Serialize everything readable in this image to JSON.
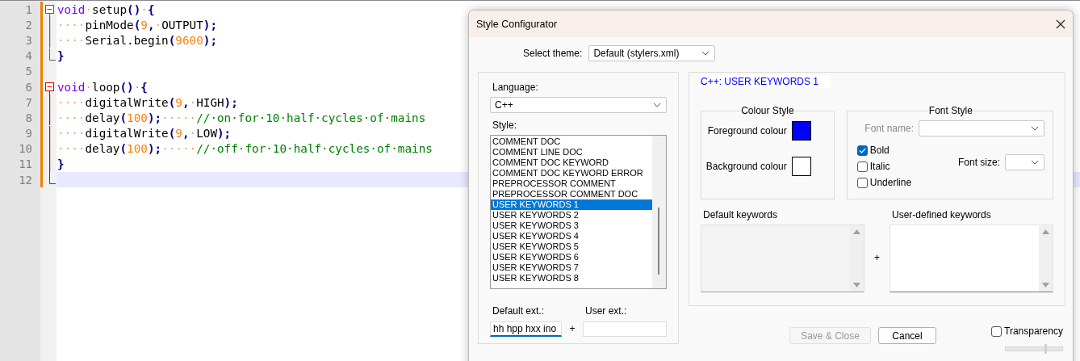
{
  "editor": {
    "lines": [
      {
        "number": "1",
        "changed": true,
        "kind": "open",
        "active_block": false,
        "current": false,
        "tokens": [
          {
            "kind": "kw",
            "text": "void"
          },
          {
            "kind": "ws",
            "text": "·"
          },
          {
            "kind": "id",
            "text": "setup"
          },
          {
            "kind": "op",
            "text": "()"
          },
          {
            "kind": "ws",
            "text": "·"
          },
          {
            "kind": "op",
            "text": "{"
          }
        ]
      },
      {
        "number": "2",
        "changed": true,
        "kind": "line",
        "active_block": false,
        "current": false,
        "tokens": [
          {
            "kind": "ws",
            "text": "····"
          },
          {
            "kind": "id",
            "text": "pinMode"
          },
          {
            "kind": "op",
            "text": "("
          },
          {
            "kind": "num",
            "text": "9"
          },
          {
            "kind": "op",
            "text": ","
          },
          {
            "kind": "ws",
            "text": "·"
          },
          {
            "kind": "id",
            "text": "OUTPUT"
          },
          {
            "kind": "op",
            "text": ");"
          }
        ]
      },
      {
        "number": "3",
        "changed": true,
        "kind": "line",
        "active_block": false,
        "current": false,
        "tokens": [
          {
            "kind": "ws",
            "text": "····"
          },
          {
            "kind": "id",
            "text": "Serial.begin"
          },
          {
            "kind": "op",
            "text": "("
          },
          {
            "kind": "num",
            "text": "9600"
          },
          {
            "kind": "op",
            "text": ");"
          }
        ]
      },
      {
        "number": "4",
        "changed": true,
        "kind": "end",
        "active_block": false,
        "current": false,
        "tokens": [
          {
            "kind": "op",
            "text": "}"
          }
        ]
      },
      {
        "number": "5",
        "changed": true,
        "current": false
      },
      {
        "number": "6",
        "changed": true,
        "kind": "open",
        "active_block": true,
        "current": false,
        "tokens": [
          {
            "kind": "kw",
            "text": "void"
          },
          {
            "kind": "ws",
            "text": "·"
          },
          {
            "kind": "id",
            "text": "loop"
          },
          {
            "kind": "op",
            "text": "()"
          },
          {
            "kind": "ws",
            "text": "·"
          },
          {
            "kind": "op",
            "text": "{"
          }
        ]
      },
      {
        "number": "7",
        "changed": true,
        "kind": "line",
        "active_block": true,
        "current": false,
        "tokens": [
          {
            "kind": "ws",
            "text": "····"
          },
          {
            "kind": "id",
            "text": "digitalWrite"
          },
          {
            "kind": "op",
            "text": "("
          },
          {
            "kind": "num",
            "text": "9"
          },
          {
            "kind": "op",
            "text": ","
          },
          {
            "kind": "ws",
            "text": "·"
          },
          {
            "kind": "id",
            "text": "HIGH"
          },
          {
            "kind": "op",
            "text": ");"
          }
        ]
      },
      {
        "number": "8",
        "changed": true,
        "kind": "line",
        "active_block": true,
        "current": false,
        "tokens": [
          {
            "kind": "ws",
            "text": "····"
          },
          {
            "kind": "id",
            "text": "delay"
          },
          {
            "kind": "op",
            "text": "("
          },
          {
            "kind": "num",
            "text": "100"
          },
          {
            "kind": "op",
            "text": ");"
          },
          {
            "kind": "ws",
            "text": "·····"
          },
          {
            "kind": "comment",
            "text": "//·on·for·10·half·cycles·of·mains"
          }
        ]
      },
      {
        "number": "9",
        "changed": true,
        "kind": "line",
        "active_block": true,
        "current": false,
        "tokens": [
          {
            "kind": "ws",
            "text": "····"
          },
          {
            "kind": "id",
            "text": "digitalWrite"
          },
          {
            "kind": "op",
            "text": "("
          },
          {
            "kind": "num",
            "text": "9"
          },
          {
            "kind": "op",
            "text": ","
          },
          {
            "kind": "ws",
            "text": "·"
          },
          {
            "kind": "id",
            "text": "LOW"
          },
          {
            "kind": "op",
            "text": ");"
          }
        ]
      },
      {
        "number": "10",
        "changed": true,
        "kind": "line",
        "active_block": true,
        "current": false,
        "tokens": [
          {
            "kind": "ws",
            "text": "····"
          },
          {
            "kind": "id",
            "text": "delay"
          },
          {
            "kind": "op",
            "text": "("
          },
          {
            "kind": "num",
            "text": "100"
          },
          {
            "kind": "op",
            "text": ");"
          },
          {
            "kind": "ws",
            "text": "·····"
          },
          {
            "kind": "comment",
            "text": "//·off·for·10·half·cycles·of·mains"
          }
        ]
      },
      {
        "number": "11",
        "changed": true,
        "kind": "line",
        "active_block": true,
        "current": false,
        "tokens": [
          {
            "kind": "op",
            "text": "}"
          }
        ]
      },
      {
        "number": "12",
        "changed": true,
        "kind": "end",
        "active_block": true,
        "current": true
      }
    ]
  },
  "dialog": {
    "title": "Style Configurator",
    "theme": {
      "label": "Select theme:",
      "value": "Default (stylers.xml)"
    },
    "language": {
      "label": "Language:",
      "value": "C++"
    },
    "style": {
      "label": "Style:",
      "items": [
        {
          "label": "COMMENT DOC",
          "selected": false
        },
        {
          "label": "COMMENT LINE DOC",
          "selected": false
        },
        {
          "label": "COMMENT DOC KEYWORD",
          "selected": false
        },
        {
          "label": "COMMENT DOC KEYWORD ERROR",
          "selected": false
        },
        {
          "label": "PREPROCESSOR COMMENT",
          "selected": false
        },
        {
          "label": "PREPROCESSOR COMMENT DOC",
          "selected": false
        },
        {
          "label": "USER KEYWORDS 1",
          "selected": true
        },
        {
          "label": "USER KEYWORDS 2",
          "selected": false
        },
        {
          "label": "USER KEYWORDS 3",
          "selected": false
        },
        {
          "label": "USER KEYWORDS 4",
          "selected": false
        },
        {
          "label": "USER KEYWORDS 5",
          "selected": false
        },
        {
          "label": "USER KEYWORDS 6",
          "selected": false
        },
        {
          "label": "USER KEYWORDS 7",
          "selected": false
        },
        {
          "label": "USER KEYWORDS 8",
          "selected": false
        }
      ]
    },
    "default_ext": {
      "label": "Default ext.:",
      "value": "hh hpp hxx ino"
    },
    "plus": "+",
    "user_ext": {
      "label": "User ext.:"
    },
    "style_title": "C++: USER KEYWORDS 1",
    "colour_style": {
      "title": "Colour Style",
      "foreground": {
        "label": "Foreground colour",
        "color": "#0000ff"
      },
      "background": {
        "label": "Background colour",
        "color": "#ffffff"
      }
    },
    "font_style": {
      "title": "Font Style",
      "font_name": {
        "label": "Font name:",
        "disabled": true
      },
      "checks": [
        {
          "label": "Bold",
          "checked": true
        },
        {
          "label": "Italic",
          "checked": false
        },
        {
          "label": "Underline",
          "checked": false
        }
      ],
      "font_size": {
        "label": "Font size:"
      }
    },
    "default_keywords": {
      "label": "Default keywords",
      "disabled": true
    },
    "keywords_plus": "+",
    "user_keywords": {
      "label": "User-defined keywords",
      "disabled": false
    },
    "buttons": [
      {
        "label": "Save & Close",
        "disabled": true
      },
      {
        "label": "Cancel",
        "disabled": false
      }
    ],
    "transparency": {
      "label": "Transparency",
      "checked": false,
      "level": 0.7
    }
  }
}
